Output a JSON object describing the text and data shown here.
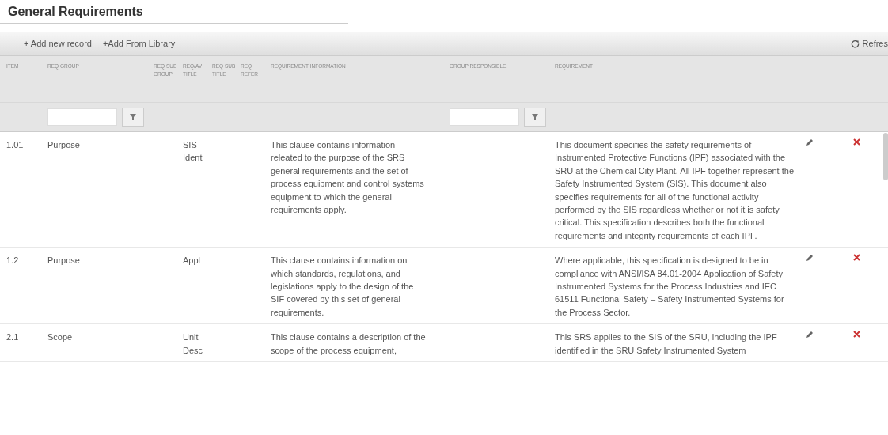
{
  "title": "General Requirements",
  "toolbar": {
    "add_new": "+ Add new record",
    "add_library": "+Add From Library",
    "refresh": "Refres"
  },
  "columns": [
    {
      "label": "ITEM",
      "filter": false
    },
    {
      "label": "REQ GROUP",
      "filter": true
    },
    {
      "label": "REQ SUB GROUP",
      "filter": false
    },
    {
      "label": "REQ/AV TITLE",
      "filter": false
    },
    {
      "label": "REQ SUB TITLE",
      "filter": false
    },
    {
      "label": "REQ REFER",
      "filter": false
    },
    {
      "label": "REQUIREMENT INFORMATION",
      "filter": false
    },
    {
      "label": "GROUP RESPONSIBLE",
      "filter": true
    },
    {
      "label": "REQUIREMENT",
      "filter": false
    }
  ],
  "rows": [
    {
      "item": "1.01",
      "group": "Purpose",
      "title": "SIS Ident",
      "information": "This clause contains information releated to the purpose of the SRS general requirements and the set of process equipment and control systems equipment to which the general requirements apply.",
      "requirement": "This document specifies the safety requirements of Instrumented Protective Functions (IPF) associated with the SRU at the Chemical City Plant. All IPF together represent the Safety Instrumented System (SIS). This document also specifies requirements for all of the functional activity performed by the SIS regardless whether or not it is safety critical. This specification describes both the functional requirements and integrity requirements of each IPF."
    },
    {
      "item": "1.2",
      "group": "Purpose",
      "title": "Appl",
      "information": "This clause contains information on which standards, regulations, and legislations apply to the design of the SIF covered by this set of general requirements.",
      "requirement": "Where applicable, this specification is designed to be in compliance with ANSI/ISA 84.01-2004 Application of Safety Instrumented Systems for the Process Industries and IEC 61511 Functional Safety – Safety Instrumented Systems for the Process Sector."
    },
    {
      "item": "2.1",
      "group": "Scope",
      "title": "Unit Desc",
      "information": "This clause contains a description of the scope of the process equipment,",
      "requirement": "This SRS applies to the SIS of the SRU, including the IPF identified in the SRU Safety Instrumented System"
    }
  ]
}
